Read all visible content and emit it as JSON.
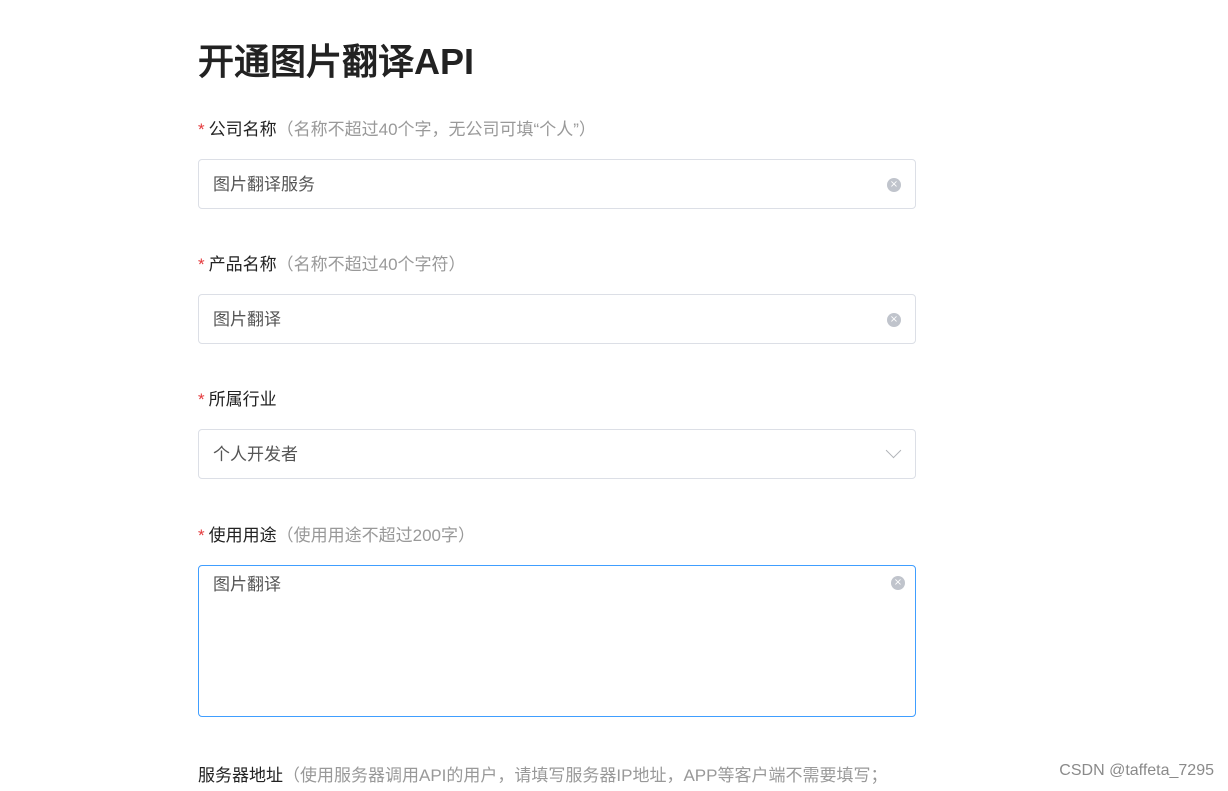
{
  "page": {
    "title": "开通图片翻译API"
  },
  "fields": {
    "company": {
      "required_mark": "*",
      "label": "公司名称",
      "hint": "（名称不超过40个字，无公司可填“个人”）",
      "value": "图片翻译服务",
      "clear_icon": "×"
    },
    "product": {
      "required_mark": "*",
      "label": "产品名称",
      "hint": "（名称不超过40个字符）",
      "value": "图片翻译",
      "clear_icon": "×"
    },
    "industry": {
      "required_mark": "*",
      "label": "所属行业",
      "value": "个人开发者"
    },
    "usage": {
      "required_mark": "*",
      "label": "使用用途",
      "hint": "（使用用途不超过200字）",
      "value": "图片翻译",
      "clear_icon": "×"
    },
    "server": {
      "label": "服务器地址",
      "hint": "（使用服务器调用API的用户，请填写服务器IP地址，APP等客户端不需要填写；"
    }
  },
  "watermark": "CSDN @taffeta_7295",
  "colors": {
    "required": "#e4393c",
    "hint": "#999999",
    "focus_border": "#409eff",
    "border": "#dcdfe6"
  }
}
